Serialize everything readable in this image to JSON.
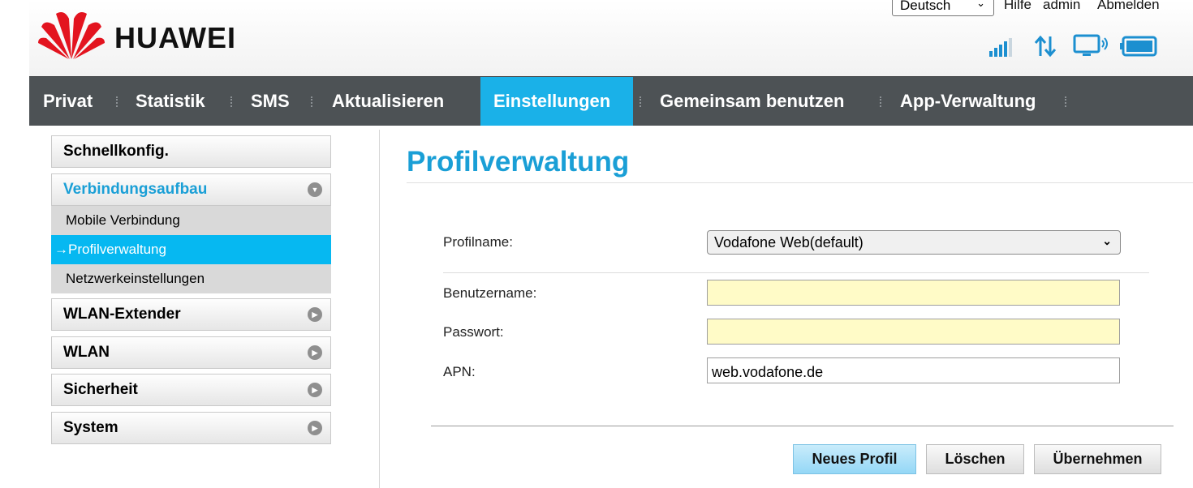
{
  "header": {
    "brand": "HUAWEI",
    "language_selected": "Deutsch",
    "links": {
      "help": "Hilfe",
      "user": "admin",
      "logout": "Abmelden"
    }
  },
  "nav": {
    "items": [
      {
        "label": "Privat"
      },
      {
        "label": "Statistik"
      },
      {
        "label": "SMS"
      },
      {
        "label": "Aktualisieren"
      },
      {
        "label": "Einstellungen"
      },
      {
        "label": "Gemeinsam benutzen"
      },
      {
        "label": "App-Verwaltung"
      }
    ],
    "active_index": 4
  },
  "sidebar": {
    "quick": "Schnellkonfig.",
    "connection": {
      "label": "Verbindungsaufbau",
      "sub": [
        {
          "label": "Mobile Verbindung"
        },
        {
          "label": "Profilverwaltung",
          "active": true
        },
        {
          "label": "Netzwerkeinstellungen"
        }
      ]
    },
    "sections": [
      {
        "label": "WLAN-Extender"
      },
      {
        "label": "WLAN"
      },
      {
        "label": "Sicherheit"
      },
      {
        "label": "System"
      }
    ]
  },
  "main": {
    "title": "Profilverwaltung",
    "form": {
      "profile_label": "Profilname:",
      "profile_value": "Vodafone Web(default)",
      "username_label": "Benutzername:",
      "username_value": "",
      "password_label": "Passwort:",
      "password_value": "",
      "apn_label": "APN:",
      "apn_value": "web.vodafone.de"
    },
    "buttons": {
      "new_profile": "Neues Profil",
      "delete": "Löschen",
      "apply": "Übernehmen"
    }
  },
  "colors": {
    "accent": "#1ab1e8",
    "nav_bg": "#4d5255",
    "active_sub": "#06b8f1",
    "title": "#1a9fd6",
    "field_highlight": "#fffbc7"
  },
  "icons": [
    "huawei-logo-icon",
    "signal-icon",
    "data-transfer-icon",
    "monitor-icon",
    "battery-icon",
    "chevron-down-icon",
    "arrow-right-icon",
    "circle-arrow-icon"
  ]
}
